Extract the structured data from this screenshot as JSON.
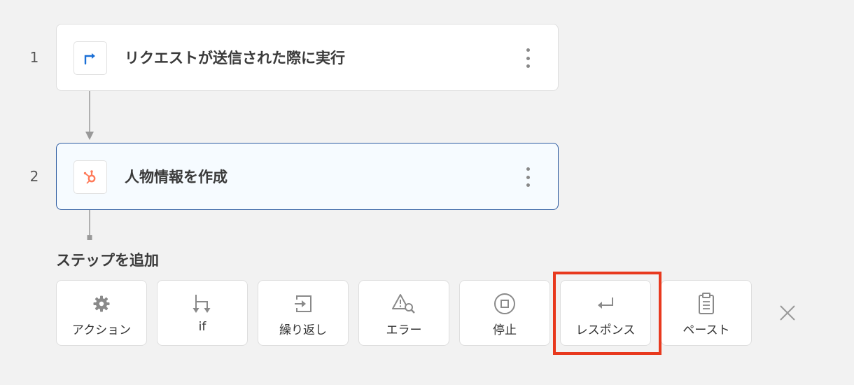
{
  "flow": {
    "steps": [
      {
        "number": "1",
        "title": "リクエストが送信された際に実行",
        "icon": "webhook-arrow-icon",
        "accent": "#1a6fd6"
      },
      {
        "number": "2",
        "title": "人物情報を作成",
        "icon": "hubspot-icon",
        "accent": "#ff7a59"
      }
    ]
  },
  "add_step": {
    "title": "ステップを追加",
    "actions": [
      {
        "label": "アクション",
        "icon": "gear-icon"
      },
      {
        "label": "if",
        "icon": "branch-icon"
      },
      {
        "label": "繰り返し",
        "icon": "loop-icon"
      },
      {
        "label": "エラー",
        "icon": "error-search-icon"
      },
      {
        "label": "停止",
        "icon": "stop-icon"
      },
      {
        "label": "レスポンス",
        "icon": "return-icon"
      },
      {
        "label": "ペースト",
        "icon": "clipboard-icon"
      }
    ],
    "close_icon": "close-icon"
  },
  "colors": {
    "highlight": "#e8391e",
    "selected_border": "#2c5aa0",
    "icon_gray": "#8a8a8a"
  }
}
